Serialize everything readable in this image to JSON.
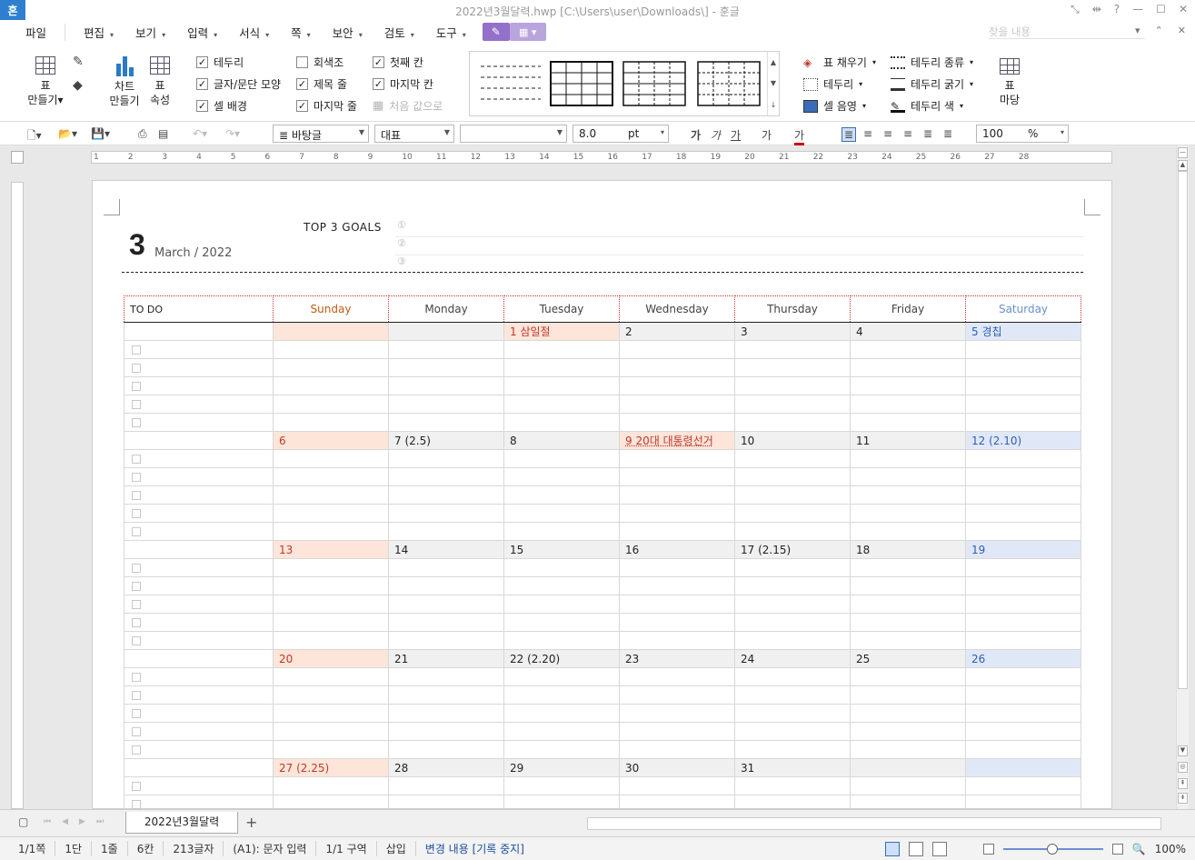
{
  "window": {
    "app_logo": "혼",
    "title": "2022년3월달력.hwp [C:\\Users\\user\\Downloads\\] - 훈글",
    "controls": [
      "⤡",
      "⇹",
      "?",
      "—",
      "☐",
      "✕"
    ]
  },
  "menu": {
    "file": "파일",
    "items": [
      "편집",
      "보기",
      "입력",
      "서식",
      "쪽",
      "보안",
      "검토",
      "도구"
    ],
    "search_placeholder": "찾을 내용",
    "right_icons": [
      "▾",
      "⌃",
      "✕"
    ]
  },
  "ribbon": {
    "table_make": [
      "표",
      "만들기"
    ],
    "chart_make": [
      "차트",
      "만들기"
    ],
    "table_props": [
      "표",
      "속성"
    ],
    "checks": [
      {
        "label": "테두리",
        "checked": true
      },
      {
        "label": "글자/문단 모양",
        "checked": true
      },
      {
        "label": "셀 배경",
        "checked": true
      },
      {
        "label": "회색조",
        "checked": false
      },
      {
        "label": "제목 줄",
        "checked": true
      },
      {
        "label": "마지막 줄",
        "checked": true
      },
      {
        "label": "첫째 칸",
        "checked": true
      },
      {
        "label": "마지막 칸",
        "checked": true
      }
    ],
    "reset_label": "처음 값으로",
    "right_items": [
      "표 채우기",
      "테두리",
      "셀 음영",
      "테두리 종류",
      "테두리 굵기",
      "테두리 색"
    ],
    "table_yard": [
      "표",
      "마당"
    ]
  },
  "format_toolbar": {
    "style": "바탕글",
    "font_lang": "대표",
    "font": "",
    "size": "8.0",
    "size_unit": "pt",
    "zoom": "100",
    "zoom_unit": "%",
    "char_buttons": [
      "가",
      "가",
      "가",
      "가",
      "가"
    ]
  },
  "ruler": {
    "ticks": [
      "1",
      "2",
      "3",
      "4",
      "5",
      "6",
      "7",
      "8",
      "9",
      "10",
      "11",
      "12",
      "13",
      "14",
      "15",
      "16",
      "17",
      "18",
      "19",
      "20",
      "21",
      "22",
      "23",
      "24",
      "25",
      "26",
      "27",
      "28"
    ]
  },
  "document": {
    "month_number": "3",
    "month_year": "March  /  2022",
    "goals_title": "TOP 3 GOALS",
    "goal_markers": [
      "①",
      "②",
      "③"
    ],
    "calendar": {
      "todo_header": "TO DO",
      "days": [
        "Sunday",
        "Monday",
        "Tuesday",
        "Wednesday",
        "Thursday",
        "Friday",
        "Saturday"
      ],
      "weeks": [
        [
          "",
          "",
          "1  삼일절",
          "2",
          "3",
          "4",
          "5  경칩"
        ],
        [
          "6",
          "7  (2.5)",
          "8",
          "9  20대 대통령선거",
          "10",
          "11",
          "12  (2.10)"
        ],
        [
          "13",
          "14",
          "15",
          "16",
          "17  (2.15)",
          "18",
          "19"
        ],
        [
          "20",
          "21",
          "22  (2.20)",
          "23",
          "24",
          "25",
          "26"
        ],
        [
          "27  (2.25)",
          "28",
          "29",
          "30",
          "31",
          "",
          ""
        ]
      ]
    }
  },
  "tabs": {
    "sheet": "2022년3월달력",
    "add": "+"
  },
  "status": {
    "page": "1/1쪽",
    "column": "1단",
    "line": "1줄",
    "col": "6칸",
    "chars": "213글자",
    "cell": "(A1): 문자 입력",
    "section": "1/1 구역",
    "mode": "삽입",
    "track": "변경 내용 [기록 중지]",
    "zoom": "100%"
  },
  "colors": {
    "accent": "#9370c9",
    "sunday_bg": "#fde5da",
    "saturday_bg": "#e0e8f8",
    "sunday_text": "#c0392b",
    "saturday_text": "#3060b0"
  }
}
